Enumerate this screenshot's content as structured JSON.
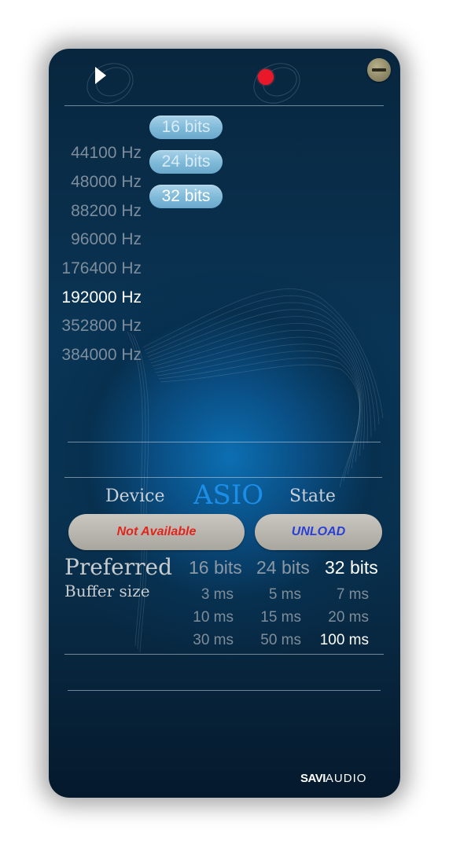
{
  "transport": {
    "play_icon": "play-icon",
    "record_icon": "record-icon",
    "minimize_icon": "minimize-icon"
  },
  "sample_rates": [
    {
      "label": "44100 Hz",
      "selected": false
    },
    {
      "label": "48000 Hz",
      "selected": false
    },
    {
      "label": "88200 Hz",
      "selected": false
    },
    {
      "label": "96000 Hz",
      "selected": false
    },
    {
      "label": "176400 Hz",
      "selected": false
    },
    {
      "label": "192000 Hz",
      "selected": true
    },
    {
      "label": "352800 Hz",
      "selected": false
    },
    {
      "label": "384000 Hz",
      "selected": false
    }
  ],
  "bit_depths": [
    {
      "label": "16 bits",
      "selected": false
    },
    {
      "label": "24 bits",
      "selected": false
    },
    {
      "label": "32 bits",
      "selected": true
    }
  ],
  "asio": {
    "device_label": "Device",
    "title": "ASIO",
    "state_label": "State",
    "device_button": "Not Available",
    "state_button": "UNLOAD"
  },
  "preferred": {
    "title": "Preferred",
    "subtitle": "Buffer size",
    "bits": [
      {
        "label": "16 bits",
        "selected": false
      },
      {
        "label": "24 bits",
        "selected": false
      },
      {
        "label": "32 bits",
        "selected": true
      }
    ],
    "buffer_rows": [
      [
        {
          "label": "3 ms",
          "selected": false
        },
        {
          "label": "5 ms",
          "selected": false
        },
        {
          "label": "7 ms",
          "selected": false
        }
      ],
      [
        {
          "label": "10 ms",
          "selected": false
        },
        {
          "label": "15 ms",
          "selected": false
        },
        {
          "label": "20 ms",
          "selected": false
        }
      ],
      [
        {
          "label": "30 ms",
          "selected": false
        },
        {
          "label": "50 ms",
          "selected": false
        },
        {
          "label": "100 ms",
          "selected": true
        }
      ]
    ]
  },
  "logo": {
    "brand": "SAVI",
    "suffix": "AUDIO"
  },
  "colors": {
    "accent": "#1d8ee8",
    "not_available": "#e2241c",
    "unload": "#2a3fd6",
    "record": "#e8182a"
  }
}
